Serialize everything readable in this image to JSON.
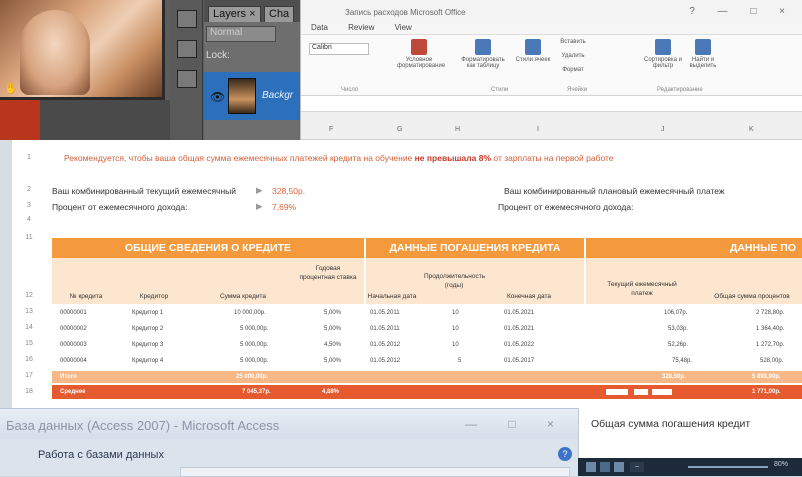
{
  "photoshop": {
    "tabs": [
      "Layers ×",
      "Cha"
    ],
    "blend_mode": "Normal",
    "lock_label": "Lock:",
    "layer_name": "Backgr"
  },
  "excel": {
    "title": "Запись расходов Microsoft Office",
    "window_controls": "? — □ ×",
    "ribbon_tabs": [
      "Data",
      "Review",
      "View"
    ],
    "font_name": "Calibri",
    "buttons": [
      "Условное форматирование",
      "Форматировать как таблицу",
      "Стили ячеек",
      "Вставить",
      "Удалить",
      "Формат",
      "Сортировка и фильтр",
      "Найти и выделить"
    ],
    "groups": [
      "Число",
      "Стили",
      "Ячейки",
      "Редактирование"
    ],
    "columns": [
      "F",
      "G",
      "H",
      "I",
      "J",
      "K"
    ]
  },
  "sheet": {
    "row_numbers": [
      "1",
      "2",
      "3",
      "4",
      "11",
      "12",
      "13",
      "14",
      "15",
      "16",
      "17",
      "18"
    ],
    "note": "Рекомендуется, чтобы ваша общая сумма ежемесячных платежей кредита на обучение",
    "note_bold": "не превышала 8%",
    "note_tail": "от зарплаты на первой работе",
    "line1_label": "Ваш комбинированный текущий ежемесячный",
    "line1_value": "328,50р.",
    "line2_label": "Процент от ежемесячного дохода:",
    "line2_value": "7,69%",
    "right1_label": "Ваш комбинированный плановый ежемесячный платеж",
    "right2_label": "Процент от ежемесячного дохода:",
    "band1": "ОБЩИЕ СВЕДЕНИЯ О КРЕДИТЕ",
    "band2": "ДАННЫЕ ПОГАШЕНИЯ КРЕДИТА",
    "band3": "ДАННЫЕ ПО",
    "sub_headers": [
      "№ кредита",
      "Кредитор",
      "Сумма кредита",
      "Годовая процентная ставка",
      "Начальная дата",
      "Продолжительность (годы)",
      "Конечная дата",
      "Текущий ежемесячный платеж",
      "Общая сумма процентов"
    ],
    "rows": [
      [
        "00000001",
        "Кредитор 1",
        "10 000,00р.",
        "5,00%",
        "01.05.2011",
        "10",
        "01.05.2021",
        "106,07р.",
        "2 728,80р."
      ],
      [
        "00000002",
        "Кредитор 2",
        "5 000,00р.",
        "5,00%",
        "01.05.2011",
        "10",
        "01.05.2021",
        "53,03р.",
        "1 364,40р."
      ],
      [
        "00000003",
        "Кредитор 3",
        "5 000,00р.",
        "4,50%",
        "01.05.2012",
        "10",
        "01.05.2022",
        "52,26р.",
        "1 272,70р."
      ],
      [
        "00000004",
        "Кредитор 4",
        "5 000,00р.",
        "5,00%",
        "01.05.2012",
        "5",
        "01.05.2017",
        "75,48р.",
        "528,00р."
      ]
    ],
    "total_label": "Итого",
    "total_amount": "25 000,00р.",
    "total_payment": "328,50р.",
    "total_interest": "5 893,90р.",
    "avg_label": "Среднее",
    "avg_amount": "7 045,37р.",
    "avg_rate": "4,88%",
    "avg_interest": "1 771,00р."
  },
  "access": {
    "title": "База данных (Access 2007) - Microsoft Access",
    "window_controls": "— □ ×",
    "ribbon_tab": "Работа с базами данных"
  },
  "tooltip": {
    "text": "Общая сумма погашения кредит"
  },
  "taskbar": {
    "zoom": "80%"
  }
}
